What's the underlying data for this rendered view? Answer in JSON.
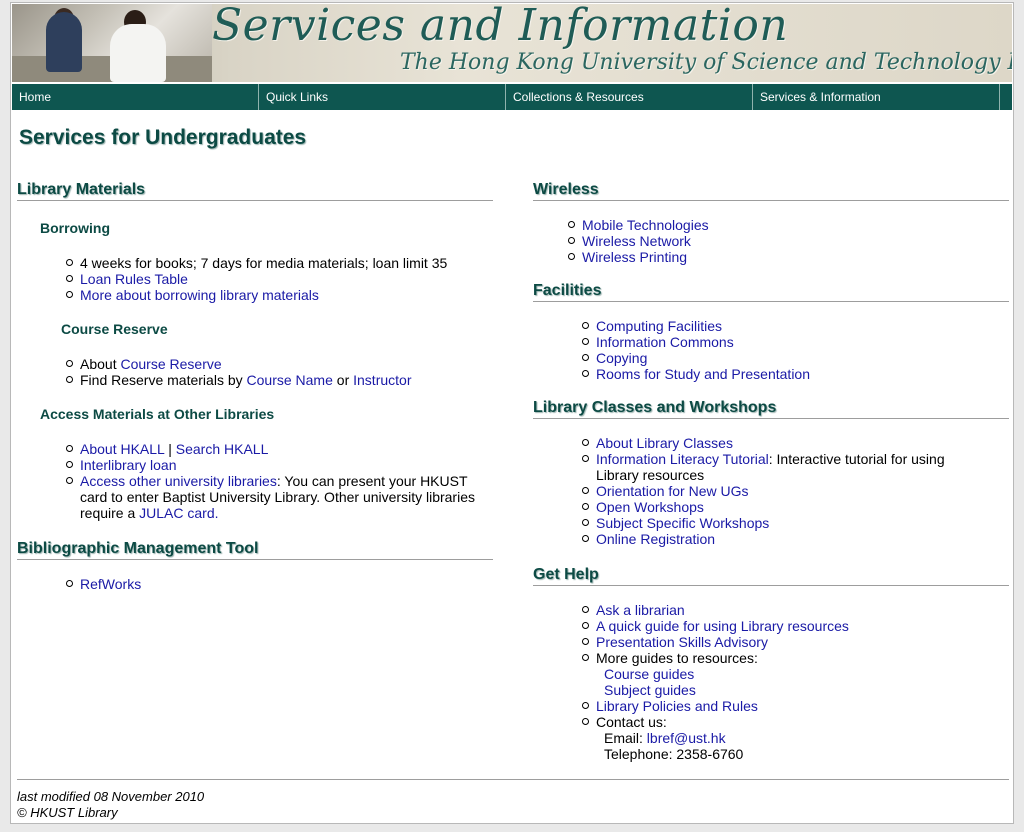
{
  "banner": {
    "title": "Services and Information",
    "subtitle": "The Hong Kong University of Science and Technology Library"
  },
  "nav": {
    "items": [
      "Home",
      "Quick Links",
      "Collections & Resources",
      "Services & Information"
    ]
  },
  "page_title": "Services for Undergraduates",
  "left": {
    "library_materials": {
      "heading": "Library Materials",
      "borrowing": {
        "heading": "Borrowing",
        "item1": "4 weeks for books; 7 days for media materials; loan limit 35",
        "item2": "Loan Rules Table",
        "item3": "More about borrowing library materials"
      },
      "course_reserve": {
        "heading": "Course Reserve",
        "about_prefix": "About ",
        "about_link": "Course Reserve",
        "find_prefix": "Find Reserve materials by ",
        "find_link1": "Course Name",
        "find_or": " or ",
        "find_link2": "Instructor"
      },
      "other_libraries": {
        "heading": "Access Materials at Other Libraries",
        "about_hkall": "About HKALL",
        "separator": " | ",
        "search_hkall": "Search HKALL",
        "interlibrary": "Interlibrary loan",
        "access_link": "Access other university libraries",
        "access_text": ": You can present your HKUST card to enter Baptist University Library. Other university libraries require a ",
        "julac_link": "JULAC card."
      }
    },
    "bibliographic": {
      "heading": "Bibliographic Management Tool",
      "refworks": "RefWorks"
    }
  },
  "right": {
    "wireless": {
      "heading": "Wireless",
      "items": [
        "Mobile Technologies",
        "Wireless Network",
        "Wireless Printing"
      ]
    },
    "facilities": {
      "heading": "Facilities",
      "items": [
        "Computing Facilities",
        "Information Commons",
        "Copying",
        "Rooms for Study and Presentation"
      ]
    },
    "classes": {
      "heading": "Library Classes and Workshops",
      "about": "About Library Classes",
      "ilt_link": "Information Literacy Tutorial",
      "ilt_text": ": Interactive tutorial for using Library resources",
      "orientation": "Orientation for New UGs",
      "open": "Open Workshops",
      "subject": "Subject Specific Workshops",
      "online": "Online Registration"
    },
    "help": {
      "heading": "Get Help",
      "ask": "Ask a librarian",
      "quick_guide": "A quick guide for using Library resources",
      "presentation": "Presentation Skills Advisory",
      "more_guides": "More guides to resources:",
      "course_guides": "Course guides",
      "subject_guides": "Subject guides",
      "policies": "Library Policies and Rules",
      "contact": "Contact us:",
      "email_label": "Email: ",
      "email": "lbref@ust.hk",
      "telephone": "Telephone: 2358-6760"
    }
  },
  "footer": {
    "modified": "last modified 08 November 2010",
    "copyright": "© HKUST Library"
  }
}
